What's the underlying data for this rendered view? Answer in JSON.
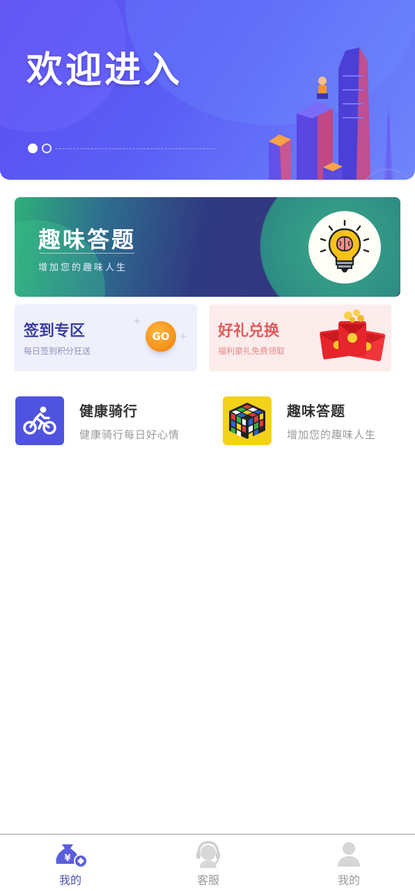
{
  "banner": {
    "title": "欢迎进入",
    "page_indicator": {
      "current": 1,
      "total": 2
    }
  },
  "quiz_banner": {
    "title": "趣味答题",
    "subtitle": "增加您的趣味人生"
  },
  "checkin_card": {
    "title": "签到专区",
    "subtitle": "每日签到积分狂送",
    "go_label": "GO"
  },
  "gift_card": {
    "title": "好礼兑换",
    "subtitle": "福利豪礼免费领取"
  },
  "features": [
    {
      "title": "健康骑行",
      "subtitle": "健康骑行每日好心情",
      "icon": "cycling-icon"
    },
    {
      "title": "趣味答题",
      "subtitle": "增加您的趣味人生",
      "icon": "rubiks-cube-icon"
    }
  ],
  "tabbar": {
    "tabs": [
      {
        "label": "我的",
        "icon": "money-bag-icon",
        "active": true
      },
      {
        "label": "客服",
        "icon": "customer-service-icon",
        "active": false
      },
      {
        "label": "我的",
        "icon": "user-icon",
        "active": false
      }
    ]
  },
  "colors": {
    "banner": "#5a4cf0",
    "primary": "#4f53df",
    "tab_active": "#4b4fb0",
    "tab_inactive": "#9a9a9a",
    "go_button": "#f28a12",
    "gift_text": "#e05a5a"
  }
}
